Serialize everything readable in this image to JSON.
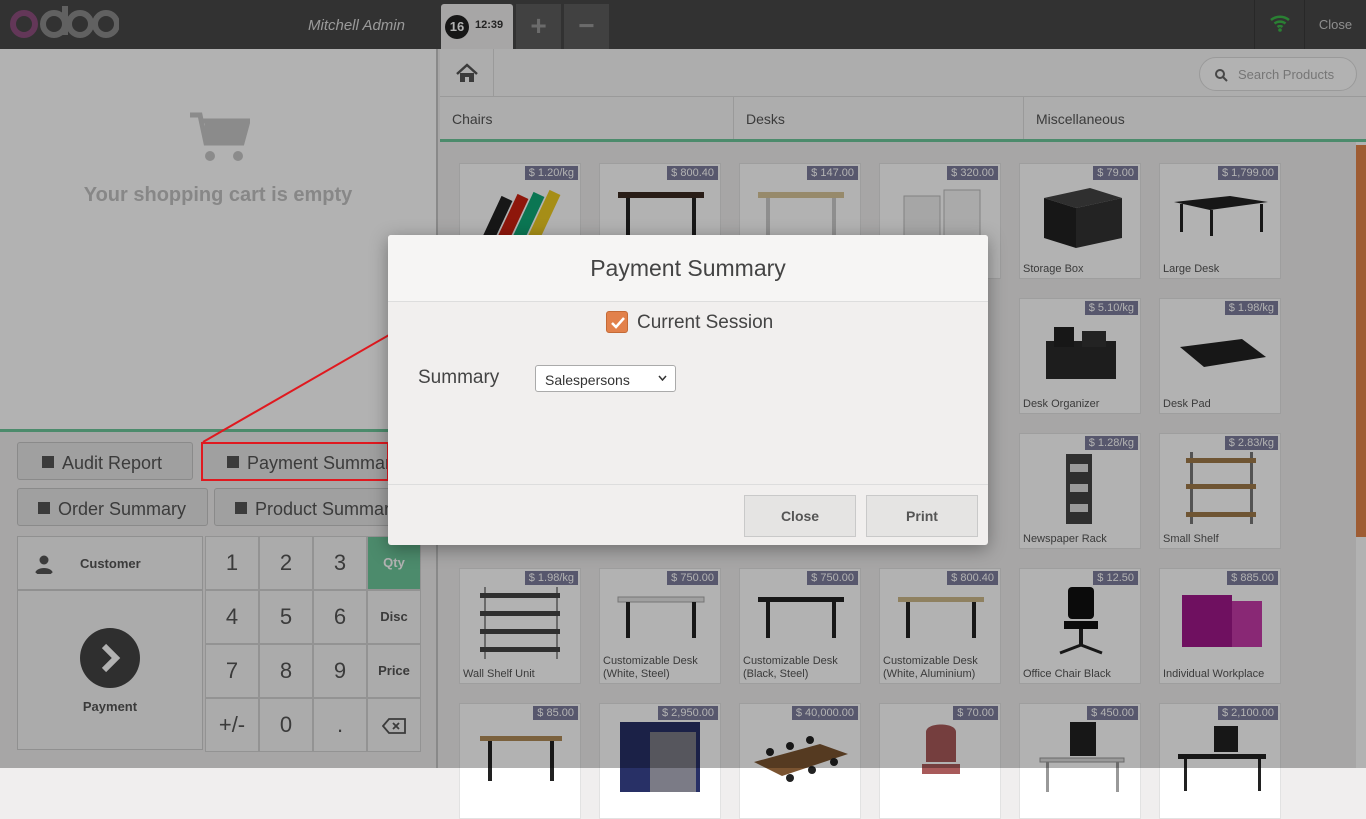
{
  "topbar": {
    "logo_text": "odoo",
    "user": "Mitchell Admin",
    "order_number": "16",
    "order_time": "12:39",
    "add_label": "+",
    "remove_label": "−",
    "close_label": "Close"
  },
  "cart": {
    "empty_text": "Your shopping cart is empty"
  },
  "control_buttons": {
    "audit_report": "Audit Report",
    "payment_summary": "Payment Summary",
    "order_summary": "Order Summary",
    "product_summary": "Product Summary"
  },
  "actionpad": {
    "customer": "Customer",
    "payment": "Payment"
  },
  "numpad": {
    "keys": [
      "1",
      "2",
      "3",
      "4",
      "5",
      "6",
      "7",
      "8",
      "9",
      "+/-",
      "0",
      "."
    ],
    "modes": [
      "Qty",
      "Disc",
      "Price"
    ],
    "active_mode": "Qty"
  },
  "search": {
    "placeholder": "Search Products"
  },
  "categories": [
    "Chairs",
    "Desks",
    "Miscellaneous"
  ],
  "products": [
    {
      "name": "",
      "price": "$ 1.20/kg"
    },
    {
      "name": "",
      "price": "$ 800.40"
    },
    {
      "name": "",
      "price": "$ 147.00"
    },
    {
      "name": "",
      "price": "$ 320.00"
    },
    {
      "name": "Storage Box",
      "price": "$ 79.00"
    },
    {
      "name": "Large Desk",
      "price": "$ 1,799.00"
    },
    {
      "name": "Desk Organizer",
      "price": "$ 5.10/kg"
    },
    {
      "name": "Desk Pad",
      "price": "$ 1.98/kg"
    },
    {
      "name": "Newspaper Rack",
      "price": "$ 1.28/kg"
    },
    {
      "name": "Small Shelf",
      "price": "$ 2.83/kg"
    },
    {
      "name": "Wall Shelf Unit",
      "price": "$ 1.98/kg"
    },
    {
      "name": "Customizable Desk (White, Steel)",
      "price": "$ 750.00"
    },
    {
      "name": "Customizable Desk (Black, Steel)",
      "price": "$ 750.00"
    },
    {
      "name": "Customizable Desk (White, Aluminium)",
      "price": "$ 800.40"
    },
    {
      "name": "Office Chair Black",
      "price": "$ 12.50"
    },
    {
      "name": "Individual Workplace",
      "price": "$ 885.00"
    },
    {
      "name": "",
      "price": "$ 85.00"
    },
    {
      "name": "",
      "price": "$ 2,950.00"
    },
    {
      "name": "",
      "price": "$ 40,000.00"
    },
    {
      "name": "",
      "price": "$ 70.00"
    },
    {
      "name": "",
      "price": "$ 450.00"
    },
    {
      "name": "",
      "price": "$ 2,100.00"
    }
  ],
  "dialog": {
    "title": "Payment Summary",
    "checkbox_label": "Current Session",
    "checkbox_checked": true,
    "summary_label": "Summary",
    "summary_value": "Salespersons",
    "close_button": "Close",
    "print_button": "Print"
  },
  "colors": {
    "accent": "#6ec89b",
    "checkbox": "#e2814b",
    "price_tag": "#7d7d9c",
    "highlight": "#e0191f"
  }
}
